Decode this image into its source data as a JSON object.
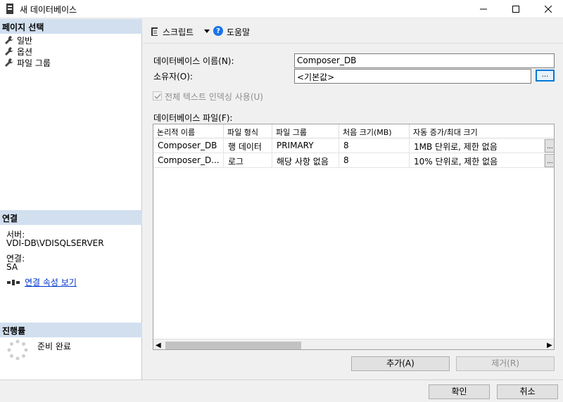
{
  "window": {
    "title": "새 데이터베이스"
  },
  "left": {
    "page_select_header": "페이지 선택",
    "pages": [
      {
        "label": "일반"
      },
      {
        "label": "옵션"
      },
      {
        "label": "파일 그룹"
      }
    ],
    "connection_header": "연결",
    "server_label": "서버:",
    "server_value": "VDI-DB\\VDISQLSERVER",
    "connection_label": "연결:",
    "connection_value": "SA",
    "view_props_link": "연결 속성 보기",
    "progress_header": "진행률",
    "progress_status": "준비 완료"
  },
  "toolbar": {
    "script_label": "스크립트",
    "help_label": "도움말"
  },
  "form": {
    "dbname_label": "데이터베이스 이름(N):",
    "dbname_value": "Composer_DB",
    "owner_label": "소유자(O):",
    "owner_value": "<기본값>",
    "ellipsis": "...",
    "fulltext_label": "전체 텍스트 인덱싱 사용(U)",
    "files_label": "데이터베이스 파일(F):"
  },
  "grid": {
    "columns": [
      "논리적 이름",
      "파일 형식",
      "파일 그룹",
      "처음 크기(MB)",
      "자동 증가/최대 크기"
    ],
    "rows": [
      [
        "Composer_DB",
        "행 데이터",
        "PRIMARY",
        "8",
        "1MB 단위로, 제한 없음"
      ],
      [
        "Composer_D...",
        "로그",
        "해당 사항 없음",
        "8",
        "10% 단위로, 제한 없음"
      ]
    ],
    "cell_button": "..."
  },
  "buttons": {
    "add": "추가(A)",
    "remove": "제거(R)",
    "ok": "확인",
    "cancel": "취소"
  },
  "colors": {
    "section_header_bg": "#d1dfef",
    "link": "#0033cc",
    "focus_border": "#0078d7"
  }
}
